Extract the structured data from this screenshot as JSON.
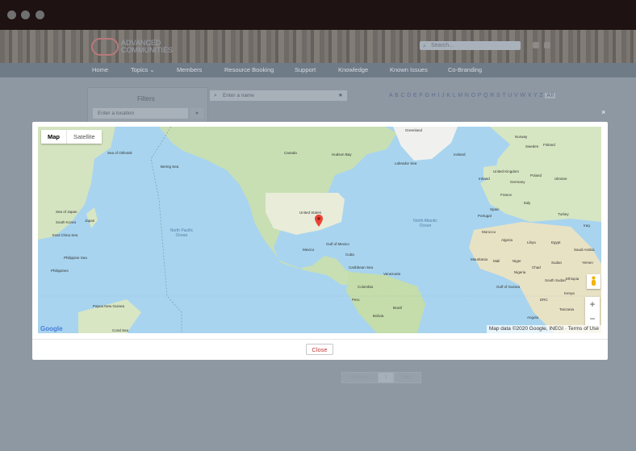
{
  "site": {
    "logo_text": "ADVANCED COMMUNITIES",
    "search_placeholder": "Search..."
  },
  "nav": {
    "items": [
      "Home",
      "Topics ⌄",
      "Members",
      "Resource Booking",
      "Support",
      "Knowledge",
      "Known Issues",
      "Co-Branding"
    ]
  },
  "filters": {
    "title": "Filters",
    "location_placeholder": "Enter a location"
  },
  "member_search": {
    "placeholder": "Enter a name"
  },
  "alphabet": {
    "letters": "A B C D E F G H I J K L M N O P Q R S T U V W X Y Z",
    "all_label": "All"
  },
  "pager": {
    "prev": "Previous",
    "page": "1",
    "next": "Next"
  },
  "modal": {
    "close_x": "×",
    "close_button": "Close"
  },
  "map": {
    "map_toggle": "Map",
    "satellite_toggle": "Satellite",
    "zoom_in": "+",
    "zoom_out": "−",
    "attribution": "Map data ©2020 Google, INEGI · Terms of Use",
    "google_logo": "Google",
    "marker_color": "#ea4335",
    "labels": {
      "greenland": "Greenland",
      "iceland": "Iceland",
      "canada": "Canada",
      "hudson_bay": "Hudson Bay",
      "labrador_sea": "Labrador Sea",
      "united_states": "United States",
      "mexico": "Mexico",
      "gulf_of_mexico": "Gulf of Mexico",
      "cuba": "Cuba",
      "caribbean_sea": "Caribbean Sea",
      "venezuela": "Venezuela",
      "colombia": "Colombia",
      "peru": "Peru",
      "brazil": "Brazil",
      "bolivia": "Bolivia",
      "north_pacific": "North Pacific Ocean",
      "north_atlantic": "North Atlantic Ocean",
      "sea_of_okhotsk": "Sea of Okhotsk",
      "bering_sea": "Bering Sea",
      "sea_of_japan": "Sea of Japan",
      "japan": "Japan",
      "south_korea": "South Korea",
      "east_china_sea": "East China Sea",
      "philippine_sea": "Philippine Sea",
      "philippines": "Philippines",
      "papua_new_guinea": "Papua New Guinea",
      "coral_sea": "Coral Sea",
      "norway": "Norway",
      "sweden": "Sweden",
      "finland": "Finland",
      "united_kingdom": "United Kingdom",
      "ireland": "Ireland",
      "germany": "Germany",
      "poland": "Poland",
      "ukraine": "Ukraine",
      "france": "France",
      "italy": "Italy",
      "spain": "Spain",
      "portugal": "Portugal",
      "turkey": "Turkey",
      "iraq": "Iraq",
      "morocco": "Morocco",
      "algeria": "Algeria",
      "libya": "Libya",
      "egypt": "Egypt",
      "saudi_arabia": "Saudi Arabia",
      "mali": "Mali",
      "niger": "Niger",
      "chad": "Chad",
      "sudan": "Sudan",
      "mauritania": "Mauritania",
      "nigeria": "Nigeria",
      "south_sudan": "South Sudan",
      "ethiopia": "Ethiopia",
      "yemen": "Yemen",
      "gulf_of_guinea": "Gulf of Guinea",
      "drc": "DRC",
      "kenya": "Kenya",
      "angola": "Angola",
      "tanzania": "Tanzania"
    }
  }
}
